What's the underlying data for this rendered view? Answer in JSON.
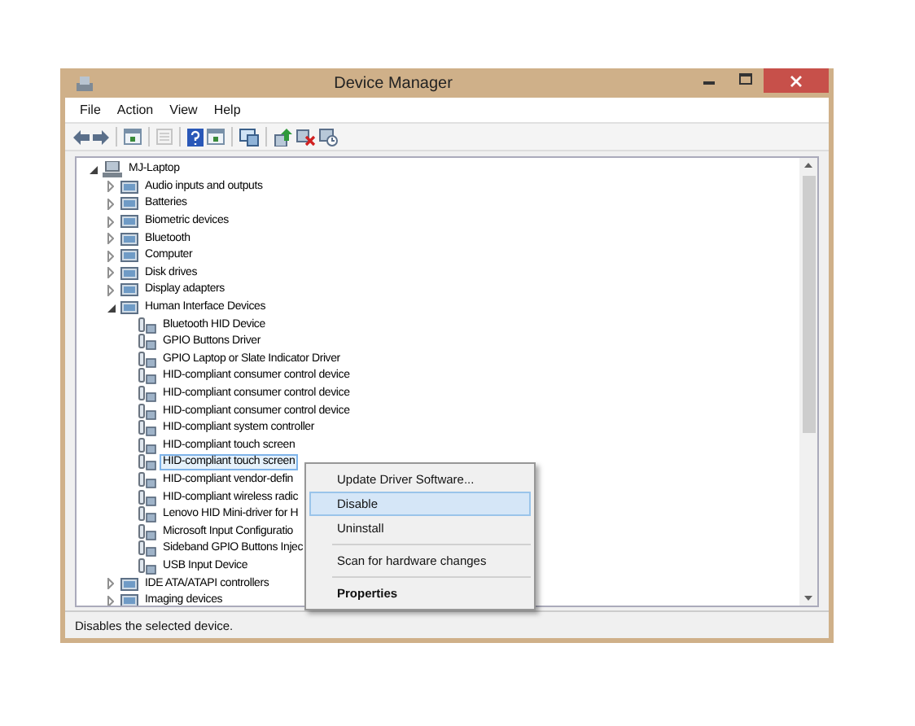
{
  "window": {
    "title": "Device Manager"
  },
  "menu_bar": [
    "File",
    "Action",
    "View",
    "Help"
  ],
  "toolbar": [
    {
      "kind": "back",
      "disabled": false
    },
    {
      "kind": "forward",
      "disabled": false
    },
    {
      "kind": "sep"
    },
    {
      "kind": "window",
      "disabled": false
    },
    {
      "kind": "sep"
    },
    {
      "kind": "properties",
      "disabled": true
    },
    {
      "kind": "sep"
    },
    {
      "kind": "help",
      "disabled": false
    },
    {
      "kind": "window",
      "disabled": false
    },
    {
      "kind": "sep"
    },
    {
      "kind": "monitor",
      "disabled": false
    },
    {
      "kind": "sep"
    },
    {
      "kind": "update",
      "disabled": false
    },
    {
      "kind": "remove",
      "disabled": false
    },
    {
      "kind": "scan",
      "disabled": false
    }
  ],
  "tree": [
    {
      "label": "MJ-Laptop",
      "expanded": true,
      "selected": false,
      "children": [
        {
          "label": "Audio inputs and outputs",
          "expanded": false,
          "selected": false
        },
        {
          "label": "Batteries",
          "expanded": false,
          "selected": false
        },
        {
          "label": "Biometric devices",
          "expanded": false,
          "selected": false
        },
        {
          "label": "Bluetooth",
          "expanded": false,
          "selected": false
        },
        {
          "label": "Computer",
          "expanded": false,
          "selected": false
        },
        {
          "label": "Disk drives",
          "expanded": false,
          "selected": false
        },
        {
          "label": "Display adapters",
          "expanded": false,
          "selected": false
        },
        {
          "label": "Human Interface Devices",
          "expanded": true,
          "selected": false,
          "children": [
            {
              "label": "Bluetooth HID Device",
              "selected": false
            },
            {
              "label": "GPIO Buttons Driver",
              "selected": false
            },
            {
              "label": "GPIO Laptop or Slate Indicator Driver",
              "selected": false
            },
            {
              "label": "HID-compliant consumer control device",
              "selected": false
            },
            {
              "label": "HID-compliant consumer control device",
              "selected": false
            },
            {
              "label": "HID-compliant consumer control device",
              "selected": false
            },
            {
              "label": "HID-compliant system controller",
              "selected": false
            },
            {
              "label": "HID-compliant touch screen",
              "selected": false
            },
            {
              "label": "HID-compliant touch screen",
              "selected": true
            },
            {
              "label": "HID-compliant vendor-defin",
              "selected": false
            },
            {
              "label": "HID-compliant wireless radic",
              "selected": false
            },
            {
              "label": "Lenovo HID Mini-driver for H",
              "selected": false
            },
            {
              "label": "Microsoft Input Configuratio",
              "selected": false
            },
            {
              "label": "Sideband GPIO Buttons Injec",
              "selected": false
            },
            {
              "label": "USB Input Device",
              "selected": false
            }
          ]
        },
        {
          "label": "IDE ATA/ATAPI controllers",
          "expanded": false,
          "selected": false
        },
        {
          "label": "Imaging devices",
          "expanded": false,
          "selected": false
        }
      ]
    }
  ],
  "context_menu": [
    {
      "kind": "item",
      "label": "Update Driver Software...",
      "selected": false,
      "default": false
    },
    {
      "kind": "item",
      "label": "Disable",
      "selected": true,
      "default": false
    },
    {
      "kind": "item",
      "label": "Uninstall",
      "selected": false,
      "default": false
    },
    {
      "kind": "separator"
    },
    {
      "kind": "item",
      "label": "Scan for hardware changes",
      "selected": false,
      "default": false
    },
    {
      "kind": "separator"
    },
    {
      "kind": "item",
      "label": "Properties",
      "selected": false,
      "default": true
    }
  ],
  "status_bar": "Disables the selected device."
}
